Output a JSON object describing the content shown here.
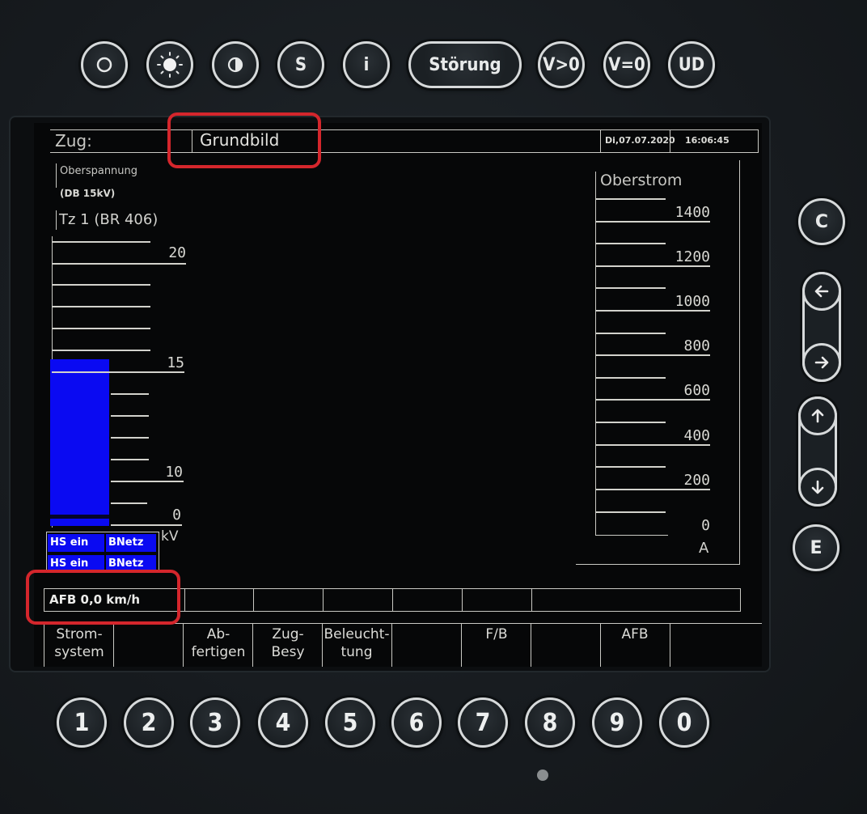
{
  "top_buttons": [
    {
      "id": "off",
      "label": "",
      "icon": "circle-icon"
    },
    {
      "id": "brightness",
      "label": "",
      "icon": "sun-icon"
    },
    {
      "id": "contrast",
      "label": "",
      "icon": "contrast-icon"
    },
    {
      "id": "s",
      "label": "S",
      "icon": ""
    },
    {
      "id": "info",
      "label": "i",
      "icon": ""
    },
    {
      "id": "stoerung",
      "label": "Störung",
      "icon": ""
    },
    {
      "id": "v_gt_0",
      "label": "V>0",
      "icon": ""
    },
    {
      "id": "v_eq_0",
      "label": "V=0",
      "icon": ""
    },
    {
      "id": "ud",
      "label": "UD",
      "icon": ""
    }
  ],
  "side_buttons": {
    "c": "C",
    "e": "E",
    "left_right_icons": [
      "arrow-left-icon",
      "arrow-right-icon"
    ],
    "up_down_icons": [
      "arrow-up-icon",
      "arrow-down-icon"
    ]
  },
  "header": {
    "zug_label": "Zug:",
    "screen_title": "Grundbild",
    "date": "Di,07.07.2020",
    "time": "16:06:45"
  },
  "voltage": {
    "title": "Oberspannung",
    "network": "(DB 15kV)",
    "unit_label": "Tz 1 (BR 406)",
    "scale": [
      "20",
      "15",
      "10",
      "0"
    ],
    "unit": "kV",
    "value_kv": 15.6,
    "scale_max_kv": 20,
    "bar_color": "#0a0af2"
  },
  "status_rows": [
    {
      "hs": "HS ein",
      "netz": "BNetz"
    },
    {
      "hs": "HS ein",
      "netz": "BNetz"
    }
  ],
  "current": {
    "title": "Oberstrom",
    "scale": [
      "1400",
      "1200",
      "1000",
      "800",
      "600",
      "400",
      "200",
      "0"
    ],
    "unit": "A"
  },
  "afb_status": "AFB 0,0 km/h",
  "softkeys": [
    {
      "line1": "Strom-",
      "line2": "system"
    },
    {
      "line1": "",
      "line2": ""
    },
    {
      "line1": "Ab-",
      "line2": "fertigen"
    },
    {
      "line1": "Zug-",
      "line2": "Besy"
    },
    {
      "line1": "Beleucht-",
      "line2": "tung"
    },
    {
      "line1": "",
      "line2": ""
    },
    {
      "line1": "F/B",
      "line2": ""
    },
    {
      "line1": "",
      "line2": ""
    },
    {
      "line1": "AFB",
      "line2": ""
    },
    {
      "line1": "",
      "line2": ""
    }
  ],
  "number_buttons": [
    "1",
    "2",
    "3",
    "4",
    "5",
    "6",
    "7",
    "8",
    "9",
    "0"
  ],
  "highlight_color": "#d4262c"
}
